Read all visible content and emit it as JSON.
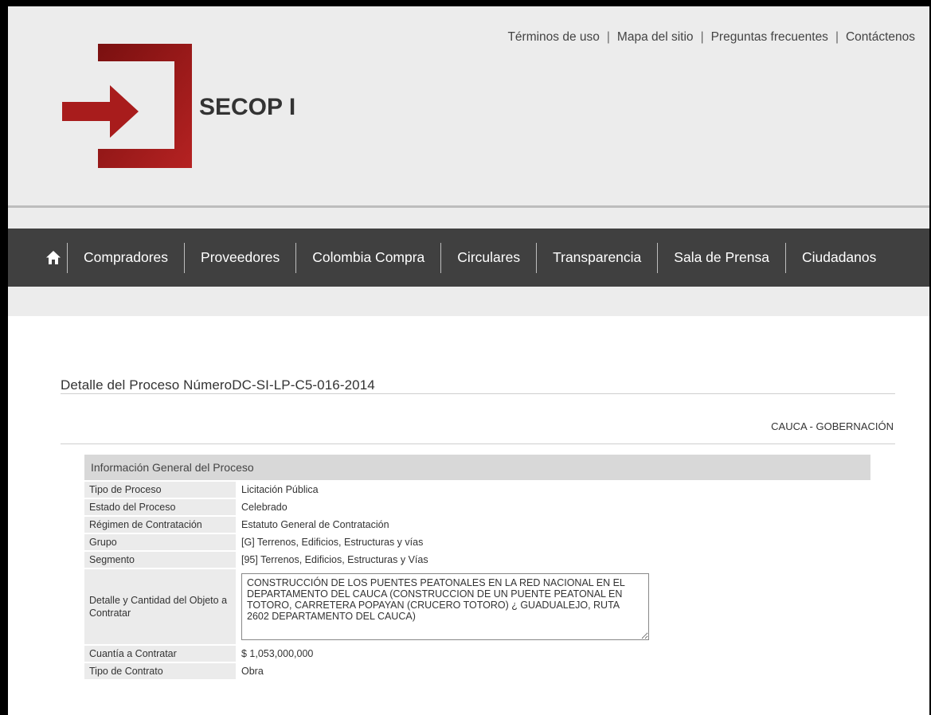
{
  "top_links": [
    "Términos de uso",
    "Mapa del sitio",
    "Preguntas frecuentes",
    "Contáctenos"
  ],
  "brand": "SECOP I",
  "nav": {
    "home_icon": "home-icon",
    "items": [
      "Compradores",
      "Proveedores",
      "Colombia Compra",
      "Circulares",
      "Transparencia",
      "Sala de Prensa",
      "Ciudadanos"
    ]
  },
  "process": {
    "title": "Detalle del Proceso NúmeroDC-SI-LP-C5-016-2014",
    "entity": "CAUCA - GOBERNACIÓN",
    "section_title": "Información General del Proceso",
    "rows": [
      {
        "label": "Tipo de Proceso",
        "value": "Licitación Pública"
      },
      {
        "label": "Estado del Proceso",
        "value": "Celebrado"
      },
      {
        "label": "Régimen de Contratación",
        "value": "Estatuto General de Contratación"
      },
      {
        "label": "Grupo",
        "value": "[G] Terrenos, Edificios, Estructuras y vías"
      },
      {
        "label": "Segmento",
        "value": "[95] Terrenos, Edificios, Estructuras y Vías"
      }
    ],
    "detail_label": "Detalle y Cantidad del Objeto a Contratar",
    "detail_value": "CONSTRUCCIÓN DE LOS PUENTES PEATONALES EN LA RED NACIONAL EN EL DEPARTAMENTO DEL CAUCA (CONSTRUCCION DE UN PUENTE PEATONAL EN TOTORO, CARRETERA POPAYAN (CRUCERO TOTORO) ¿ GUADUALEJO, RUTA 2602 DEPARTAMENTO DEL CAUCA)",
    "rows_after": [
      {
        "label": "Cuantía a Contratar",
        "value": "$ 1,053,000,000"
      },
      {
        "label": "Tipo de Contrato",
        "value": "Obra"
      }
    ]
  },
  "colors": {
    "logo_red": "#9b1c1c",
    "nav_bg": "#404040",
    "header_bg": "#ececec"
  }
}
